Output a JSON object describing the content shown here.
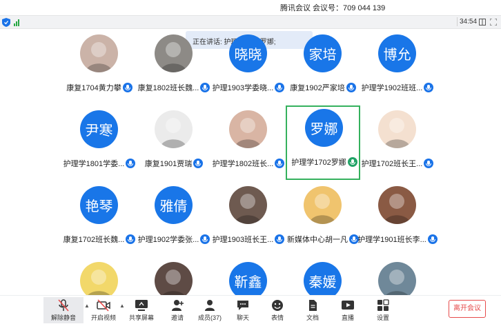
{
  "titlebar": {
    "title": "腾讯会议 会议号：709 044 139"
  },
  "statusbar": {
    "timer": "34:54"
  },
  "speaking": {
    "text": "正在讲话: 护理学1702罗娜;"
  },
  "rows": [
    [
      {
        "name": "康复1704黄力攀",
        "avatar_kind": "photo",
        "avatar_text": "",
        "photo_color": "#cbb3a8"
      },
      {
        "name": "康复1802班长魏...",
        "avatar_kind": "photo",
        "avatar_text": "",
        "photo_color": "#8d8a86"
      },
      {
        "name": "护理1903学委晓...",
        "avatar_kind": "letter",
        "avatar_text": "晓晓"
      },
      {
        "name": "康复1902严家培",
        "avatar_kind": "letter",
        "avatar_text": "家培"
      },
      {
        "name": "护理学1902班班...",
        "avatar_kind": "letter",
        "avatar_text": "博允"
      }
    ],
    [
      {
        "name": "护理学1801学委...",
        "avatar_kind": "letter",
        "avatar_text": "尹寒"
      },
      {
        "name": "康复1901贾瑞",
        "avatar_kind": "photo",
        "avatar_text": "",
        "photo_color": "#ebebeb"
      },
      {
        "name": "护理学1802班长...",
        "avatar_kind": "photo",
        "avatar_text": "",
        "photo_color": "#d9b5a4"
      },
      {
        "name": "护理学1702罗娜",
        "avatar_kind": "letter",
        "avatar_text": "罗娜",
        "active": true
      },
      {
        "name": "护理1702班长王...",
        "avatar_kind": "photo",
        "avatar_text": "",
        "photo_color": "#f4e0d0"
      }
    ],
    [
      {
        "name": "康复1702班长魏...",
        "avatar_kind": "letter",
        "avatar_text": "艳琴"
      },
      {
        "name": "护理1902学委张...",
        "avatar_kind": "letter",
        "avatar_text": "雅倩"
      },
      {
        "name": "护理1903班长王...",
        "avatar_kind": "photo",
        "avatar_text": "",
        "photo_color": "#6e5a50"
      },
      {
        "name": "新媒体中心胡一凡",
        "avatar_kind": "photo",
        "avatar_text": "",
        "photo_color": "#f0c46e"
      },
      {
        "name": "护理学1901班长李...",
        "avatar_kind": "photo",
        "avatar_text": "",
        "photo_color": "#8a5a44"
      }
    ],
    [
      {
        "name": "",
        "avatar_kind": "photo",
        "avatar_text": "",
        "photo_color": "#f2d86a"
      },
      {
        "name": "",
        "avatar_kind": "photo",
        "avatar_text": "",
        "photo_color": "#5e4b45"
      },
      {
        "name": "",
        "avatar_kind": "letter",
        "avatar_text": "靳鑫"
      },
      {
        "name": "",
        "avatar_kind": "letter",
        "avatar_text": "秦媛"
      },
      {
        "name": "",
        "avatar_kind": "photo",
        "avatar_text": "",
        "photo_color": "#6f8899"
      }
    ]
  ],
  "toolbar": {
    "mute": "解除静音",
    "video": "开启视频",
    "share": "共享屏幕",
    "invite": "邀请",
    "members": "成员(37)",
    "chat": "聊天",
    "emoji": "表情",
    "docs": "文档",
    "live": "直播",
    "settings": "设置",
    "leave": "离开会议"
  },
  "colors": {
    "accent": "#1976e8",
    "active_border": "#34b15d",
    "leave": "#e64a4a"
  }
}
